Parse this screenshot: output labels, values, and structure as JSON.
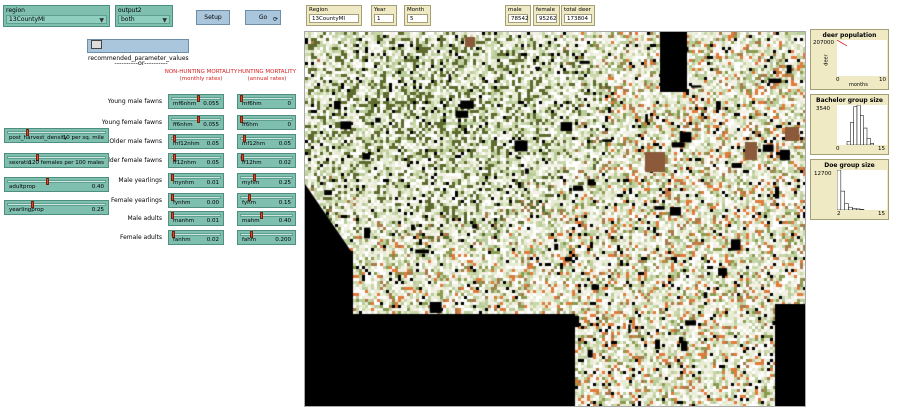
{
  "region_chooser": {
    "label": "region",
    "value": "13CountyMI"
  },
  "output_chooser": {
    "label": "output2",
    "value": "both"
  },
  "buttons": {
    "setup": "Setup",
    "go": "Go",
    "recommended": "recommended_parameter_values"
  },
  "or_text": "----------or----------",
  "headers": {
    "nonhunting": "NON-HUNTING MORTALITY",
    "nonhunting_sub": "(monthly rates)",
    "hunting": "HUNTING MORTALITY",
    "hunting_sub": "(annual rates)"
  },
  "rows": [
    {
      "label": "Young male fawns",
      "nh_name": "mf6nhm",
      "nh_value": "0.055",
      "nh_frac": 0.55,
      "h_name": "mf6hm",
      "h_value": "0",
      "h_frac": 0.0
    },
    {
      "label": "Young female fawns",
      "nh_name": "ff6nhm",
      "nh_value": "0.055",
      "nh_frac": 0.55,
      "h_name": "ff6hm",
      "h_value": "0",
      "h_frac": 0.0
    },
    {
      "label": "Older male fawns",
      "nh_name": "mf12nhm",
      "nh_value": "0.05",
      "nh_frac": 0.05,
      "h_name": "mf12hm",
      "h_value": "0.05",
      "h_frac": 0.05
    },
    {
      "label": "Older female fawns",
      "nh_name": "ff12nhm",
      "nh_value": "0.05",
      "nh_frac": 0.05,
      "h_name": "ff12hm",
      "h_value": "0.02",
      "h_frac": 0.02
    },
    {
      "label": "Male yearlings",
      "nh_name": "mynhm",
      "nh_value": "0.01",
      "nh_frac": 0.01,
      "h_name": "myhm",
      "h_value": "0.25",
      "h_frac": 0.25
    },
    {
      "label": "Female yearlings",
      "nh_name": "fynhm",
      "nh_value": "0.00",
      "nh_frac": 0.0,
      "h_name": "fyhm",
      "h_value": "0.15",
      "h_frac": 0.15
    },
    {
      "label": "Male adults",
      "nh_name": "manhm",
      "nh_value": "0.01",
      "nh_frac": 0.01,
      "h_name": "mahm",
      "h_value": "0.40",
      "h_frac": 0.4
    },
    {
      "label": "Female adults",
      "nh_name": "fanhm",
      "nh_value": "0.02",
      "nh_frac": 0.02,
      "h_name": "fahm",
      "h_value": "0.200",
      "h_frac": 0.2
    }
  ],
  "left_sliders": [
    {
      "name": "post_harvest_density",
      "value": "10 per sq. mile",
      "frac": 0.2
    },
    {
      "name": "sexratio",
      "value": "120 females per 100 males",
      "frac": 0.3
    },
    {
      "name": "adultprop",
      "value": "0.40",
      "frac": 0.4
    },
    {
      "name": "yearlingprop",
      "value": "0.25",
      "frac": 0.25
    }
  ],
  "monitors": {
    "region": {
      "label": "Region",
      "value": "13CountyMI"
    },
    "year": {
      "label": "Year",
      "value": "1"
    },
    "month": {
      "label": "Month",
      "value": "5"
    },
    "male": {
      "label": "male",
      "value": "78542"
    },
    "female": {
      "label": "female",
      "value": "95262"
    },
    "total": {
      "label": "total deer",
      "value": "173804"
    }
  },
  "plots": {
    "population": {
      "title": "deer population",
      "ymax": "207000",
      "ylabel": "deer",
      "xmin": "0",
      "xlabel": "months",
      "xmax": "10"
    },
    "bachelor": {
      "title": "Bachelor group size",
      "ymax": "3540",
      "xmin": "0",
      "xmax": "15"
    },
    "doe": {
      "title": "Doe group size",
      "ymax": "12700",
      "xmin": "2",
      "xmax": "15"
    }
  },
  "chart_data": [
    {
      "type": "line",
      "title": "deer population",
      "ylabel": "deer",
      "xlabel": "months",
      "xlim": [
        0,
        10
      ],
      "ylim": [
        0,
        207000
      ],
      "series": [
        {
          "x": [
            0,
            1,
            2
          ],
          "values": [
            207000,
            190000,
            173804
          ],
          "color": "#d62020"
        }
      ]
    },
    {
      "type": "bar",
      "title": "Bachelor group size",
      "xlim": [
        0,
        15
      ],
      "ylim": [
        0,
        3540
      ],
      "categories": [
        3,
        4,
        5,
        6,
        7,
        8,
        9,
        10
      ],
      "values": [
        300,
        2000,
        3400,
        3540,
        2600,
        1500,
        600,
        150
      ]
    },
    {
      "type": "bar",
      "title": "Doe group size",
      "xlim": [
        2,
        15
      ],
      "ylim": [
        0,
        12700
      ],
      "categories": [
        2,
        3,
        4,
        5,
        6,
        7,
        8
      ],
      "values": [
        12700,
        6000,
        2000,
        900,
        500,
        350,
        200
      ]
    }
  ],
  "colors": {
    "slider": "#7fbfb0",
    "button": "#aac6dc",
    "monitor": "#efe9c4",
    "header_red": "#d62020"
  }
}
